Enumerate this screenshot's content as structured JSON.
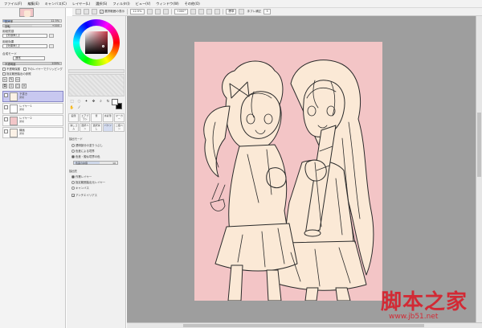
{
  "menu": [
    "ファイル(F)",
    "編集(E)",
    "キャンバス(C)",
    "レイヤー(L)",
    "選択(S)",
    "フィルタ(I)",
    "ビュー(V)",
    "ウィンドウ(W)",
    "その他(O)"
  ],
  "toolbar": {
    "checkbox_label": "選択範囲の表示",
    "zoom": "12.5%",
    "angle": "+000°",
    "mode_label": "標準",
    "stab_label": "手ブレ補正",
    "stab_value": "3"
  },
  "navigator": {
    "zoom_label": "拡大率",
    "zoom_value": "12.5%",
    "angle_label": "回転",
    "angle_value": "+000"
  },
  "layer_panel": {
    "paper_texture_label": "用紙質感",
    "paper_texture_value": "【質感無し】",
    "paper_effect_label": "用紙効果",
    "paper_effect_value": "【効果無し】",
    "blend_label": "合成モード",
    "blend_value": "通常",
    "opacity_label": "不透明度",
    "opacity_value": "100%",
    "protect_label": "不透明保護",
    "clip_label": "下のレイヤーでクリッピング",
    "ref_label": "指定範囲抽出の参照",
    "layers": [
      {
        "name": "下書き",
        "mode": "通常",
        "opacity": "100%",
        "thumb": "line",
        "selected": true
      },
      {
        "name": "レイヤー1",
        "mode": "通常",
        "opacity": "100%",
        "thumb": "blank",
        "selected": false
      },
      {
        "name": "レイヤー2",
        "mode": "通常",
        "opacity": "100%",
        "thumb": "pink",
        "selected": false
      },
      {
        "name": "線画",
        "mode": "通常",
        "opacity": "100%",
        "thumb": "line",
        "selected": false
      }
    ]
  },
  "tools": {
    "brushes": [
      "鉛筆",
      "エアブラシ",
      "筆",
      "水彩筆",
      "マーカー",
      "消しゴム",
      "選択ペン",
      "選択消し",
      "バケツ",
      "二値ペン"
    ],
    "fill_options_header": "抽出モード",
    "fill_options": [
      "透明部分の塗りつぶし",
      "色差による境界",
      "色差・擬似境界の色"
    ],
    "fill_selected": 2,
    "tolerance_label": "色差の許容",
    "tolerance_value": "10",
    "target_header": "抽出先",
    "targets": [
      "作業レイヤー",
      "指定範囲抽出元レイヤー",
      "キャンバス"
    ],
    "target_selected": 0,
    "antialias_label": "アンチエイリアス"
  },
  "colors": {
    "canvas_bg": "#f3c5c6",
    "line_color": "#2a2a2a",
    "skin_color": "#fbe9d6",
    "workspace": "#9e9e9e",
    "watermark": "#d81e2a"
  },
  "watermark": {
    "title": "脚本之家",
    "url": "www.jb51.net"
  }
}
